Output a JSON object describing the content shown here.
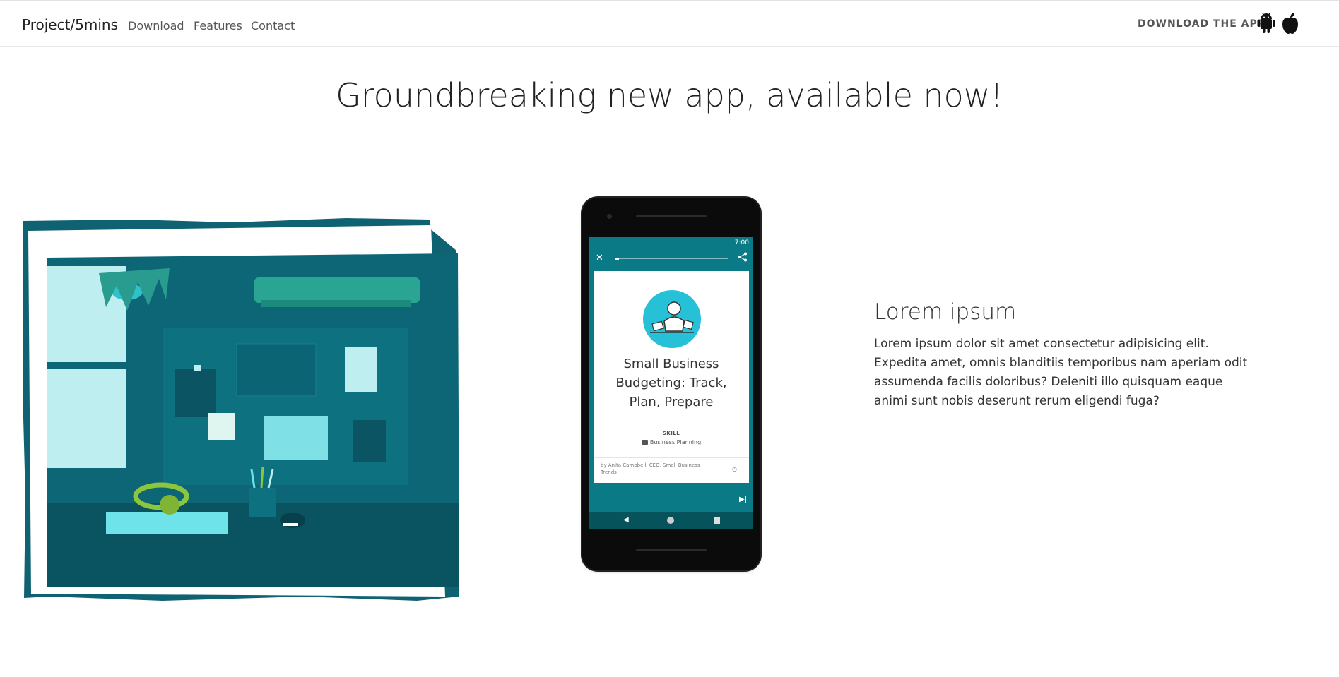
{
  "nav": {
    "brand": "Project/5mins",
    "links": [
      "Download",
      "Features",
      "Contact"
    ],
    "download_label": "DOWNLOAD THE APP",
    "icons": [
      "android-icon",
      "apple-icon"
    ]
  },
  "hero": {
    "headline": "Groundbreaking new app, available now!"
  },
  "phone": {
    "status_time": "7:00",
    "card": {
      "title": "Small Business Budgeting: Track, Plan, Prepare",
      "skill_label": "SKILL",
      "skill_value": "Business Planning",
      "author": "by Anita Campbell, CEO, Small Business Trends"
    }
  },
  "feature": {
    "title": "Lorem ipsum",
    "body": "Lorem ipsum dolor sit amet consectetur adipisicing elit. Expedita amet, omnis blanditiis temporibus nam aperiam odit assumenda facilis doloribus? Deleniti illo quisquam eaque animi sunt nobis deserunt rerum eligendi fuga?"
  },
  "colors": {
    "teal_dark": "#0b5d6b",
    "teal_mid": "#0e7180",
    "teal_light": "#bfeef0",
    "accent_green": "#8cc63f",
    "phone_screen": "#0b7a87"
  }
}
